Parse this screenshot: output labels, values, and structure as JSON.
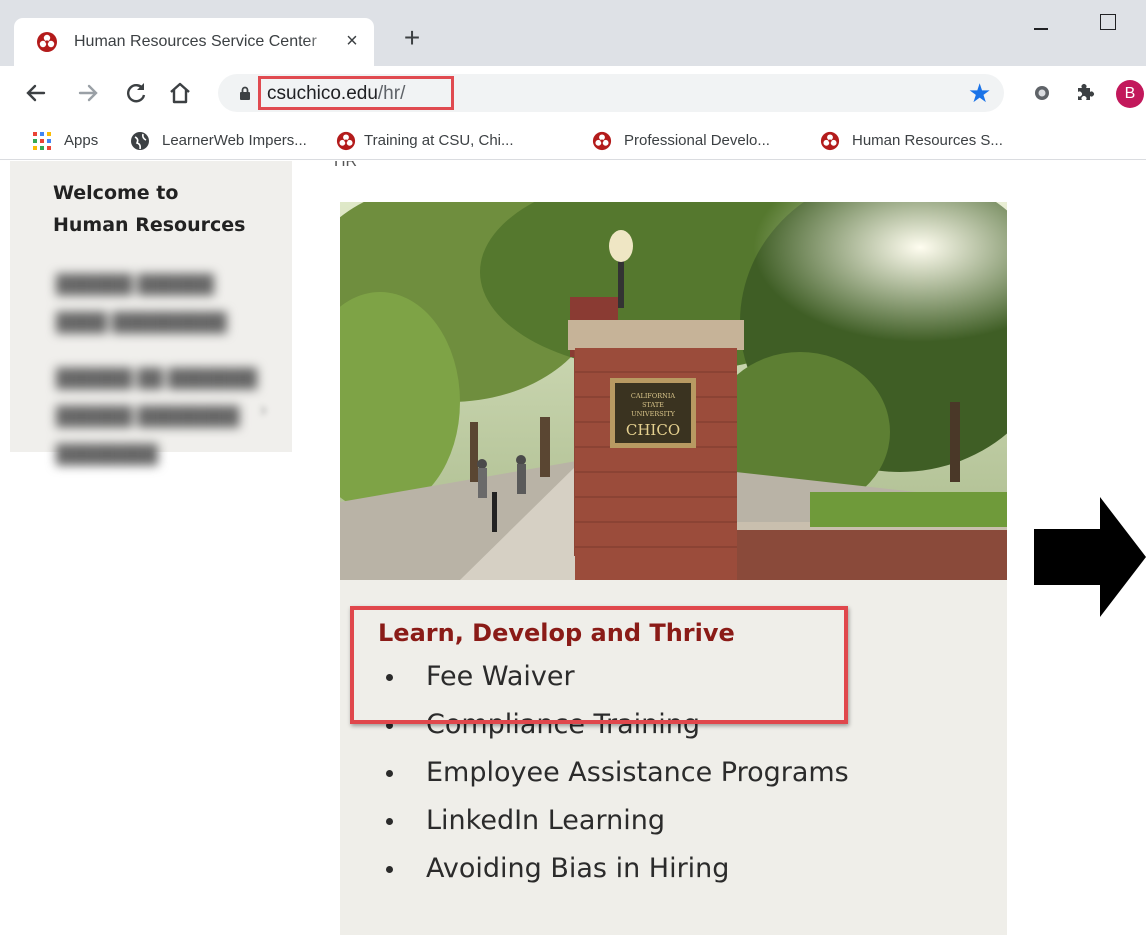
{
  "browser": {
    "tab": {
      "title": "Human Resources Service Center",
      "close_glyph": "×"
    },
    "new_tab_glyph": "+",
    "address": {
      "host": "csuchico.edu",
      "path": "/hr/"
    },
    "profile_initial": "B",
    "bookmarks": [
      {
        "label": "Apps",
        "icon": "apps-grid-icon"
      },
      {
        "label": "LearnerWeb Impers...",
        "icon": "globe-icon"
      },
      {
        "label": "Training at CSU, Chi...",
        "icon": "csu-logo-icon"
      },
      {
        "label": "Professional Develo...",
        "icon": "csu-logo-icon"
      },
      {
        "label": "Human Resources S...",
        "icon": "csu-logo-icon"
      }
    ],
    "colors": {
      "tabstrip": "#dee1e6",
      "star": "#1a73e8",
      "profile": "#c2185b",
      "annotation": "#e0474c"
    }
  },
  "page": {
    "breadcrumb": "HR",
    "sidebar": {
      "welcome_line1": "Welcome to",
      "welcome_line2": "Human Resources"
    },
    "hero_sign": {
      "line1": "CALIFORNIA",
      "line2": "STATE",
      "line3": "UNIVERSITY",
      "line4": "CHICO"
    },
    "card": {
      "heading": "Learn, Develop and Thrive",
      "items": [
        "Fee Waiver",
        "Compliance Training",
        "Employee Assistance Programs",
        "LinkedIn Learning",
        "Avoiding Bias in Hiring"
      ],
      "heading_color": "#8a1b17"
    }
  }
}
